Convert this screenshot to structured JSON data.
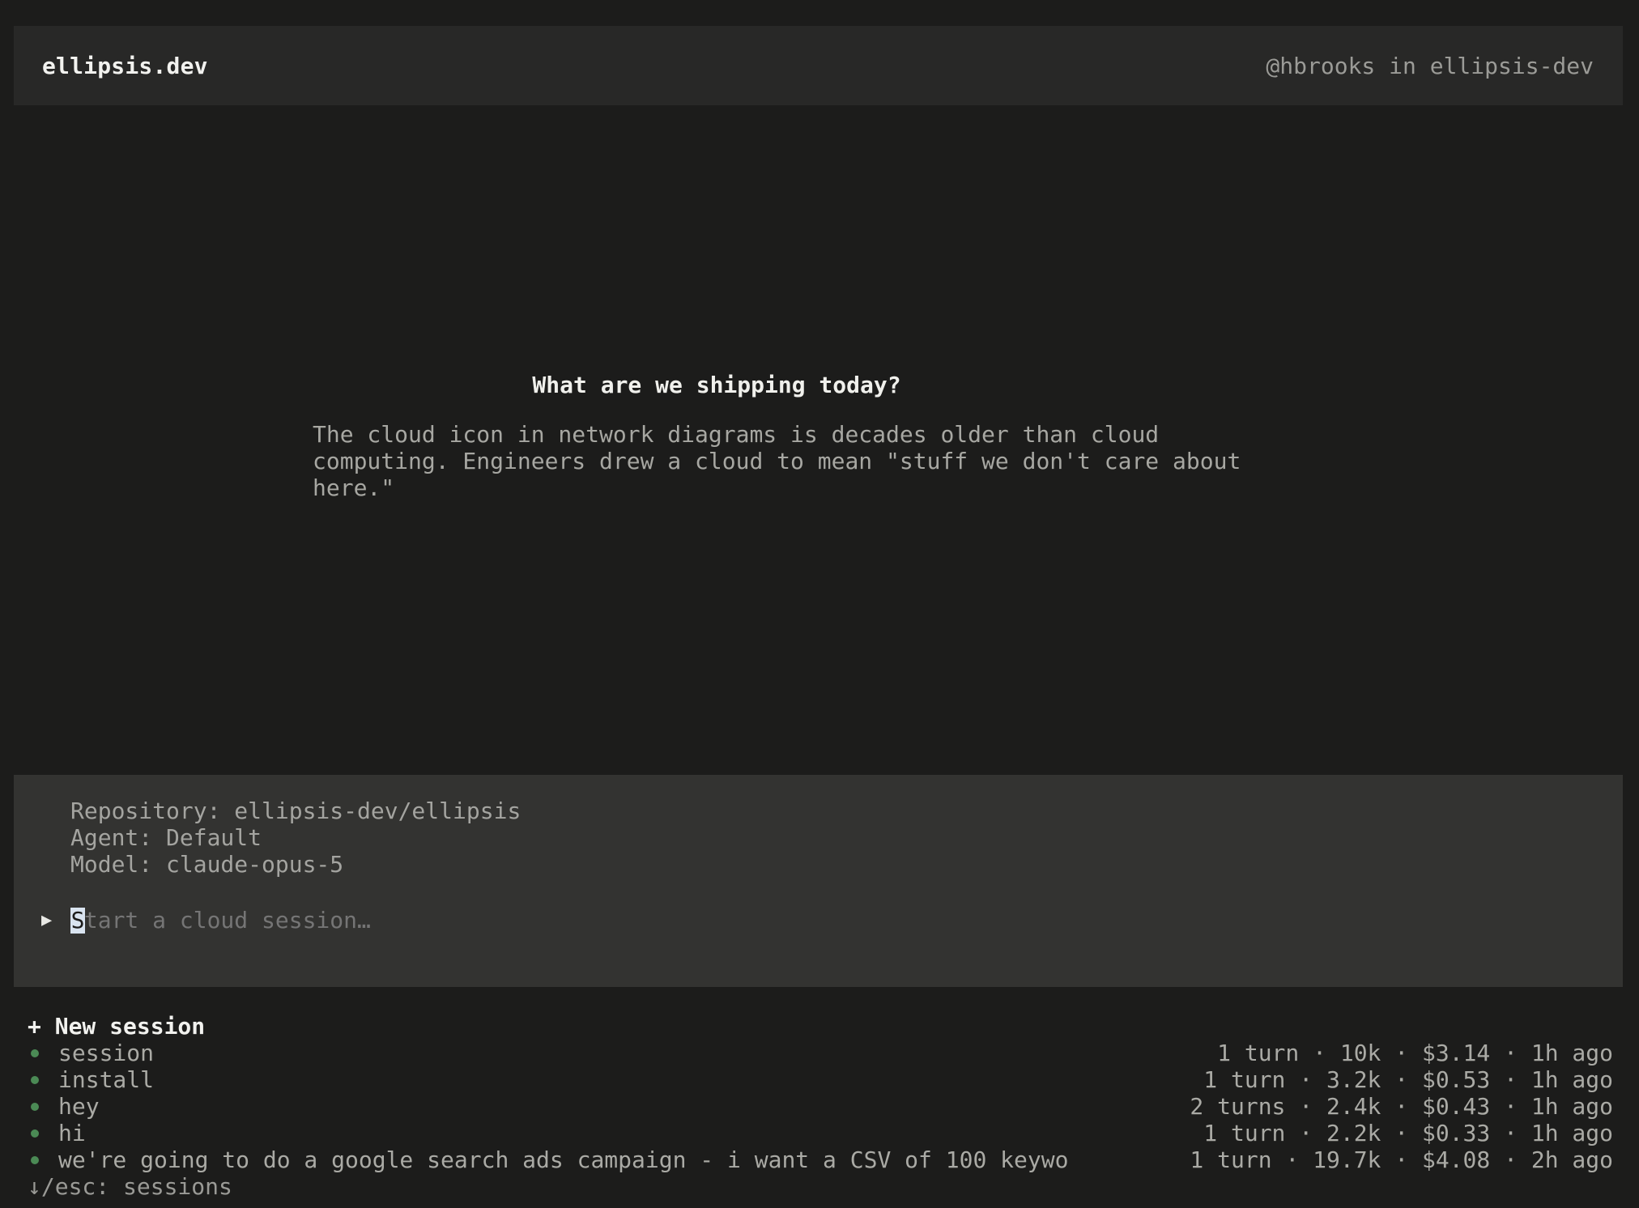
{
  "header": {
    "brand": "ellipsis.dev",
    "user_info": "@hbrooks in ellipsis-dev"
  },
  "welcome": {
    "title": "What are we shipping today?",
    "text": "The cloud icon in network diagrams is decades older than cloud\ncomputing. Engineers drew a cloud to mean \"stuff we don't care about\nhere.\""
  },
  "composer": {
    "repository": "Repository: ellipsis-dev/ellipsis",
    "agent": "Agent: Default",
    "model": "Model: claude-opus-5",
    "prompt_arrow": "▶",
    "placeholder": "Start a cloud session…",
    "caret_char": "S"
  },
  "sessions": {
    "new_label": "+ New session",
    "items": [
      {
        "title": "session",
        "meta": "1 turn · 10k · $3.14 · 1h ago"
      },
      {
        "title": "install",
        "meta": "1 turn · 3.2k · $0.53 · 1h ago"
      },
      {
        "title": "hey",
        "meta": "2 turns · 2.4k · $0.43 · 1h ago"
      },
      {
        "title": "hi",
        "meta": "1 turn · 2.2k · $0.33 · 1h ago"
      },
      {
        "title": "we're going to do a google search ads campaign - i want a CSV of 100 keywo",
        "meta": "1 turn · 19.7k · $4.08 · 2h ago"
      }
    ],
    "hint": "↓/esc: sessions",
    "status_color": "#4b8a55"
  }
}
